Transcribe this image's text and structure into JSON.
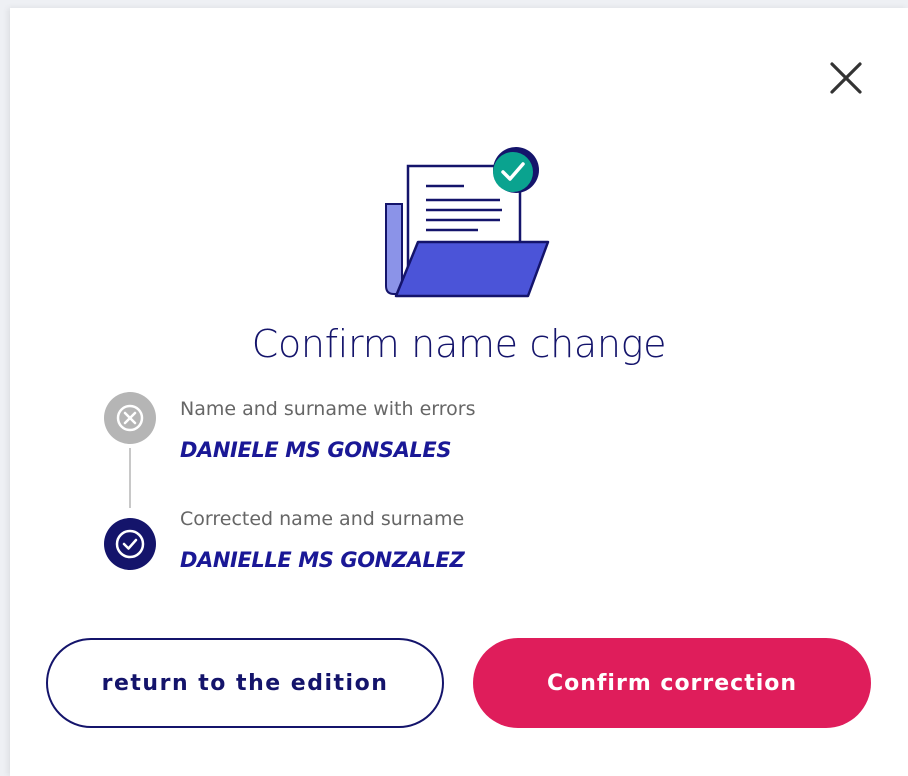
{
  "dialog": {
    "title": "Confirm name change",
    "close_icon": "close-icon",
    "illustration_icon": "document-folder-check-icon"
  },
  "steps": [
    {
      "label": "Name and surname with errors",
      "value": "DANIELE MS GONSALES",
      "icon": "error-circle-icon",
      "icon_color": "#b5b5b5"
    },
    {
      "label": "Corrected name and surname",
      "value": "DANIELLE MS GONZALEZ",
      "icon": "check-circle-icon",
      "icon_color": "#14146b"
    }
  ],
  "actions": {
    "secondary_label": "return to the edition",
    "primary_label": "Confirm correction"
  },
  "colors": {
    "primary": "#df1d5b",
    "brand_navy": "#14146b",
    "value_text": "#1a1896",
    "accent_teal": "#0aa38f"
  }
}
